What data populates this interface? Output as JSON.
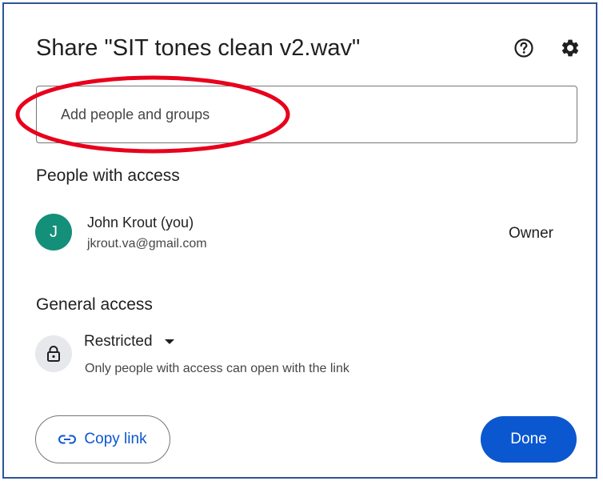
{
  "dialog": {
    "title": "Share \"SIT tones clean v2.wav\"",
    "help_icon": "help-circle-icon",
    "settings_icon": "gear-icon"
  },
  "add_people": {
    "placeholder": "Add people and groups"
  },
  "annotation": {
    "shape": "ellipse",
    "color": "#e8001c"
  },
  "people_section": {
    "title": "People with access",
    "people": [
      {
        "avatar_letter": "J",
        "avatar_color": "#148f7a",
        "name": "John Krout (you)",
        "email": "jkrout.va@gmail.com",
        "role": "Owner"
      }
    ]
  },
  "general_access": {
    "title": "General access",
    "icon": "lock-icon",
    "level": "Restricted",
    "description": "Only people with access can open with the link"
  },
  "footer": {
    "copy_link_label": "Copy link",
    "copy_link_icon": "link-icon",
    "done_label": "Done"
  },
  "colors": {
    "primary": "#0b57d0",
    "frame_border": "#2f5597",
    "text": "#1f1f1f",
    "secondary_text": "#444746"
  }
}
